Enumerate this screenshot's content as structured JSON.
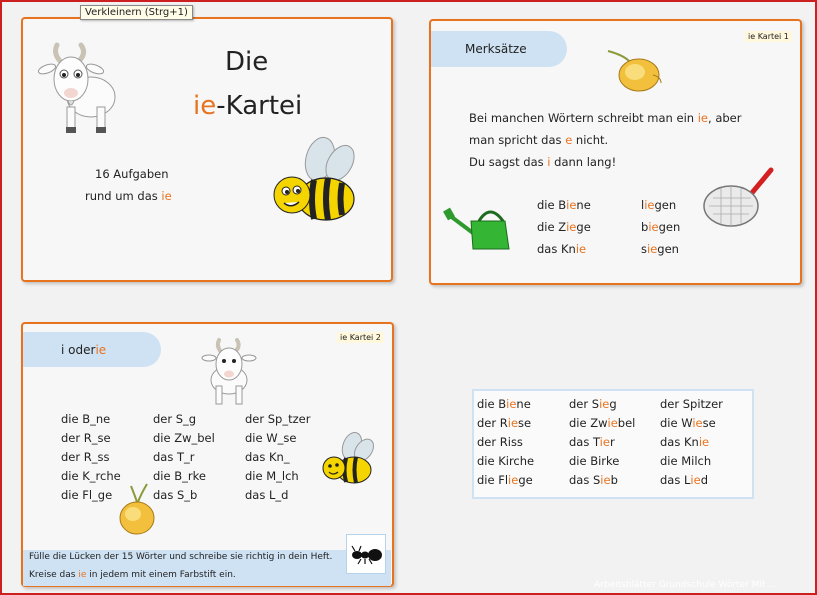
{
  "tooltip": "Verkleinern (Strg+1)",
  "card1": {
    "title_line1": "Die",
    "title_ie": "ie",
    "title_rest": "-Kartei",
    "sub_line1": "16 Aufgaben",
    "sub_line2_pre": "rund um das ",
    "sub_line2_ie": "ie"
  },
  "card2": {
    "tab_label": "Merksätze",
    "tag": "ie Kartei 1",
    "rule1_pre": "Bei manchen Wörtern schreibt man ein ",
    "rule1_ie": "ie",
    "rule1_post": ", aber",
    "rule2_pre": "man spricht das ",
    "rule2_e": "e",
    "rule2_post": " nicht.",
    "rule3_pre": "Du sagst das ",
    "rule3_i": "i",
    "rule3_post": " dann lang!",
    "nouns": [
      {
        "pre": "die B",
        "ie": "ie",
        "post": "ne"
      },
      {
        "pre": "die Z",
        "ie": "ie",
        "post": "ge"
      },
      {
        "pre": "das Kn",
        "ie": "ie",
        "post": ""
      }
    ],
    "verbs": [
      {
        "pre": "l",
        "ie": "ie",
        "post": "gen"
      },
      {
        "pre": "b",
        "ie": "ie",
        "post": "gen"
      },
      {
        "pre": "s",
        "ie": "ie",
        "post": "gen"
      }
    ]
  },
  "card3": {
    "tab_pre": "i oder ",
    "tab_ie": "ie",
    "tag": "ie Kartei 2",
    "columns": [
      [
        "die B_ne",
        "der R_se",
        "der R_ss",
        "die K_rche",
        "die Fl_ge"
      ],
      [
        "der S_g",
        "die Zw_bel",
        "das T_r",
        "die B_rke",
        "das S_b"
      ],
      [
        "der Sp_tzer",
        "die W_se",
        "das Kn_",
        "die M_lch",
        "das L_d"
      ]
    ],
    "instr1": "Fülle die Lücken der 15 Wörter und schreibe sie richtig in dein Heft.",
    "instr2_pre": "Kreise das ",
    "instr2_ie": "ie",
    "instr2_post": " in jedem mit einem Farbstift ein."
  },
  "solution": {
    "columns": [
      [
        {
          "pre": "die B",
          "hl": "ie",
          "post": "ne"
        },
        {
          "pre": "der R",
          "hl": "ie",
          "post": "se"
        },
        {
          "pre": "der Riss",
          "hl": "",
          "post": ""
        },
        {
          "pre": "die Kirche",
          "hl": "",
          "post": ""
        },
        {
          "pre": "die Fl",
          "hl": "ie",
          "post": "ge"
        }
      ],
      [
        {
          "pre": "der S",
          "hl": "ie",
          "post": "g"
        },
        {
          "pre": "die Zw",
          "hl": "ie",
          "post": "bel"
        },
        {
          "pre": "das T",
          "hl": "ie",
          "post": "r"
        },
        {
          "pre": "die Birke",
          "hl": "",
          "post": ""
        },
        {
          "pre": "das S",
          "hl": "ie",
          "post": "b"
        }
      ],
      [
        {
          "pre": "der Spitzer",
          "hl": "",
          "post": ""
        },
        {
          "pre": "die W",
          "hl": "ie",
          "post": "se"
        },
        {
          "pre": "das Kn",
          "hl": "ie",
          "post": ""
        },
        {
          "pre": "die Milch",
          "hl": "",
          "post": ""
        },
        {
          "pre": "das L",
          "hl": "ie",
          "post": "d"
        }
      ]
    ]
  },
  "watermark": "Arbeitsblätter Grundschule Wörter Mit ..."
}
